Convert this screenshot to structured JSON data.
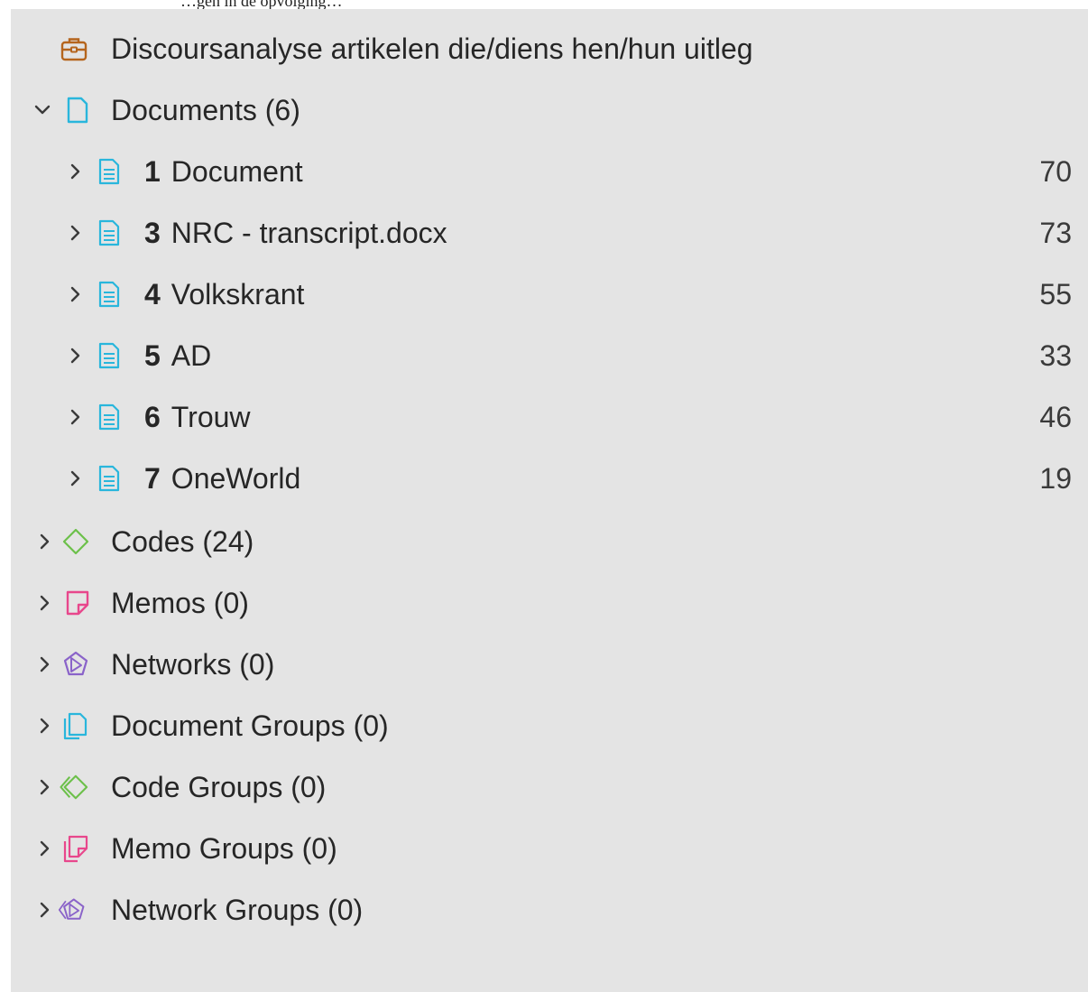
{
  "header_fragment": "…gen in de opvolging…",
  "project": {
    "title": "Discoursanalyse artikelen die/diens hen/hun uitleg",
    "icon": "briefcase-icon"
  },
  "documents_node": {
    "label": "Documents (6)",
    "expanded": true
  },
  "documents": [
    {
      "num": "1",
      "name": "Document",
      "count": "70"
    },
    {
      "num": "3",
      "name": "NRC - transcript.docx",
      "count": "73"
    },
    {
      "num": "4",
      "name": "Volkskrant",
      "count": "55"
    },
    {
      "num": "5",
      "name": "AD",
      "count": "33"
    },
    {
      "num": "6",
      "name": "Trouw",
      "count": "46"
    },
    {
      "num": "7",
      "name": "OneWorld",
      "count": "19"
    }
  ],
  "nodes": {
    "codes": "Codes (24)",
    "memos": "Memos (0)",
    "networks": "Networks (0)",
    "document_groups": "Document Groups (0)",
    "code_groups": "Code Groups (0)",
    "memo_groups": "Memo Groups (0)",
    "network_groups": "Network Groups (0)"
  },
  "colors": {
    "panel_bg": "#e4e4e4",
    "project": "#b5651d",
    "document": "#29b6dc",
    "code": "#6cc04a",
    "memo": "#e8478c",
    "network": "#8a63c9"
  }
}
